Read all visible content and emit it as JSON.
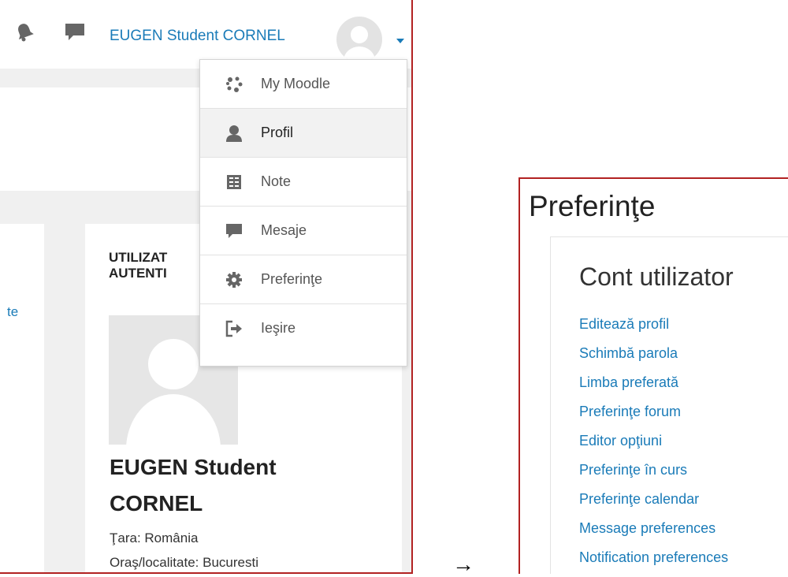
{
  "navbar": {
    "user_name": "EUGEN Student CORNEL",
    "icons": [
      "bell-icon",
      "chat-icon",
      "avatar",
      "caret-down-icon"
    ]
  },
  "user_menu": {
    "items": [
      {
        "label": "My Moodle",
        "icon": "moodle-icon"
      },
      {
        "label": "Profil",
        "icon": "user-icon"
      },
      {
        "label": "Note",
        "icon": "grades-icon"
      },
      {
        "label": "Mesaje",
        "icon": "chat-icon"
      },
      {
        "label": "Preferinţe",
        "icon": "gear-icon"
      },
      {
        "label": "Ieşire",
        "icon": "logout-icon"
      }
    ],
    "active_index": 1
  },
  "left_content": {
    "link_fragment": "te"
  },
  "user_block": {
    "title_line1": "UTILIZAT",
    "title_line2": "AUTENTI",
    "name_line1": "EUGEN Student",
    "name_line2": "CORNEL",
    "country": "Ţara: România",
    "city": "Oraş/localitate: Bucuresti"
  },
  "arrow": "→",
  "preferences": {
    "title": "Preferinţe",
    "section_title": "Cont utilizator",
    "links": [
      "Editează profil",
      "Schimbă parola",
      "Limba preferată",
      "Preferinţe forum",
      "Editor opţiuni",
      "Preferinţe în curs",
      "Preferinţe calendar",
      "Message preferences",
      "Notification preferences"
    ]
  },
  "colors": {
    "link": "#1a7bb8",
    "frame": "#b22222",
    "icon": "#555555"
  }
}
